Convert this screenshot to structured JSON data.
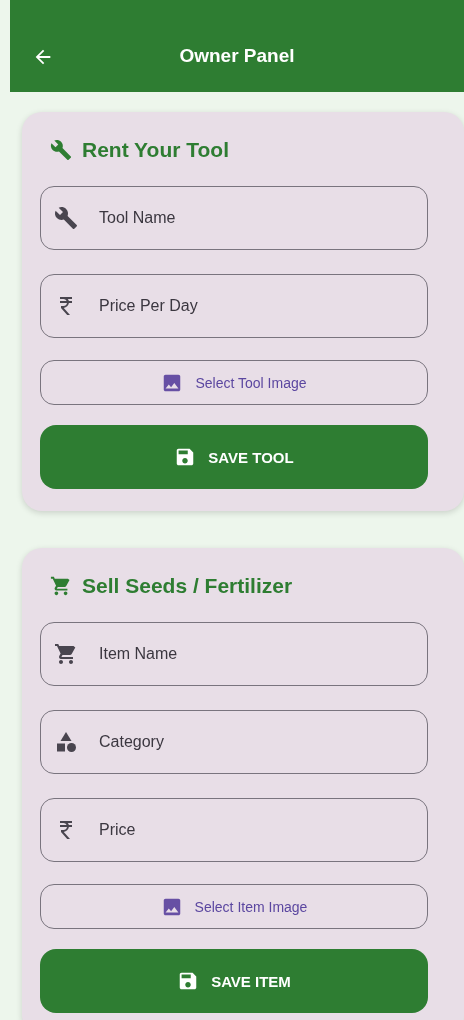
{
  "app_bar": {
    "title": "Owner Panel"
  },
  "sections": [
    {
      "title": "Rent Your Tool",
      "kind": "tool",
      "fields": [
        {
          "kind": "tool",
          "placeholder": "Tool Name"
        },
        {
          "kind": "money",
          "placeholder": "Price Per Day"
        }
      ],
      "image_button": "Select Tool Image",
      "save_button": "SAVE TOOL"
    },
    {
      "title": "Sell Seeds / Fertilizer",
      "kind": "product",
      "fields": [
        {
          "kind": "product",
          "placeholder": "Item Name"
        },
        {
          "kind": "category",
          "placeholder": "Category"
        },
        {
          "kind": "money",
          "placeholder": "Price"
        }
      ],
      "image_button": "Select Item Image",
      "save_button": "SAVE ITEM"
    }
  ]
}
